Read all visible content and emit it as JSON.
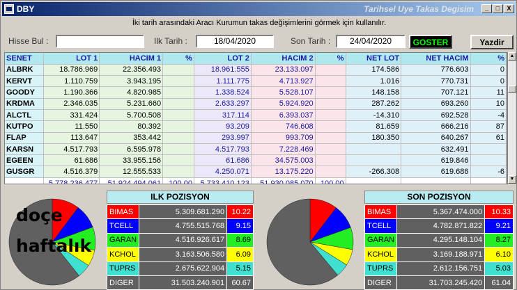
{
  "window": {
    "title": "DBY",
    "subtitle": "Tarihsel Uye Takas Degisim",
    "btn_min": "_",
    "btn_max": "□",
    "btn_close": "X"
  },
  "info_text": "İki tarih arasındaki  Aracı Kurumun takas değişimlerini görmek için kullanılır.",
  "form": {
    "hisse_label": "Hisse Bul :",
    "hisse_value": "",
    "ilk_label": "Ilk Tarih :",
    "ilk_value": "18/04/2020",
    "son_label": "Son Tarih :",
    "son_value": "24/04/2020",
    "goster": "GOSTER",
    "yazdir": "Yazdir"
  },
  "grid": {
    "headers": [
      "SENET",
      "LOT 1",
      "HACIM 1",
      "%",
      "LOT 2",
      "HACIM 2",
      "%",
      "NET LOT",
      "NET HACIM",
      "%"
    ],
    "rows": [
      [
        "ALBRK",
        "18.786.969",
        "22.356.493",
        "",
        "18.961.555",
        "23.133.097",
        "",
        "174.586",
        "776.603",
        "0"
      ],
      [
        "KERVT",
        "1.110.759",
        "3.943.195",
        "",
        "1.111.775",
        "4.713.927",
        "",
        "1.016",
        "770.731",
        "0"
      ],
      [
        "GOODY",
        "1.190.366",
        "4.820.985",
        "",
        "1.338.524",
        "5.528.107",
        "",
        "148.158",
        "707.121",
        "11"
      ],
      [
        "KRDMA",
        "2.346.035",
        "5.231.660",
        "",
        "2.633.297",
        "5.924.920",
        "",
        "287.262",
        "693.260",
        "10"
      ],
      [
        "ALCTL",
        "331.424",
        "5.700.508",
        "",
        "317.114",
        "6.393.037",
        "",
        "-14.310",
        "692.528",
        "-4"
      ],
      [
        "KUTPO",
        "11.550",
        "80.392",
        "",
        "93.209",
        "746.608",
        "",
        "81.659",
        "666.216",
        "87"
      ],
      [
        "FLAP",
        "113.647",
        "353.442",
        "",
        "293.997",
        "993.709",
        "",
        "180.350",
        "640.267",
        "61"
      ],
      [
        "KARSN",
        "4.517.793",
        "6.595.978",
        "",
        "4.517.793",
        "7.228.469",
        "",
        "",
        "632.491",
        ""
      ],
      [
        "EGEEN",
        "61.686",
        "33.955.156",
        "",
        "61.686",
        "34.575.003",
        "",
        "",
        "619.846",
        ""
      ],
      [
        "GUSGR",
        "4.516.379",
        "12.555.533",
        "",
        "4.250.071",
        "13.175.220",
        "",
        "-266.308",
        "619.686",
        "-6"
      ]
    ],
    "totals": [
      "",
      "5.778.236.477",
      "51.924.494.061",
      "100,00",
      "5.733.410.123",
      "51.930.085.070",
      "100,00",
      "",
      "",
      ""
    ]
  },
  "ilk": {
    "title": "ILK POZISYON",
    "rows": [
      {
        "name": "BIMAS",
        "value": "5.309.681.290",
        "pct": "10.22",
        "color": "#ff0000",
        "pctbg": "#ff0000"
      },
      {
        "name": "TCELL",
        "value": "4.755.515.768",
        "pct": "9.15",
        "color": "#0000ff",
        "pctbg": "#0000ff"
      },
      {
        "name": "GARAN",
        "value": "4.516.926.617",
        "pct": "8.69",
        "color": "#22ee22",
        "pctbg": "#22ee22"
      },
      {
        "name": "KCHOL",
        "value": "3.163.506.580",
        "pct": "6.09",
        "color": "#ffff00",
        "pctbg": "#ffff00"
      },
      {
        "name": "TUPRS",
        "value": "2.675.622.904",
        "pct": "5.15",
        "color": "#40e0d0",
        "pctbg": "#40e0d0"
      },
      {
        "name": "DIGER",
        "value": "31.503.240.901",
        "pct": "60.67",
        "color": "#606060",
        "pctbg": "#606060"
      }
    ]
  },
  "son": {
    "title": "SON POZISYON",
    "rows": [
      {
        "name": "BIMAS",
        "value": "5.367.474.000",
        "pct": "10.33",
        "color": "#ff0000"
      },
      {
        "name": "TCELL",
        "value": "4.782.871.822",
        "pct": "9.21",
        "color": "#0000ff"
      },
      {
        "name": "GARAN",
        "value": "4.295.148.104",
        "pct": "8.27",
        "color": "#22ee22"
      },
      {
        "name": "KCHOL",
        "value": "3.169.188.971",
        "pct": "6.10",
        "color": "#ffff00"
      },
      {
        "name": "TUPRS",
        "value": "2.612.156.751",
        "pct": "5.03",
        "color": "#40e0d0"
      },
      {
        "name": "DIGER",
        "value": "31.703.245.420",
        "pct": "61.04",
        "color": "#606060"
      }
    ]
  },
  "watermark": {
    "line1": "doçe",
    "line2": "haftalık"
  }
}
